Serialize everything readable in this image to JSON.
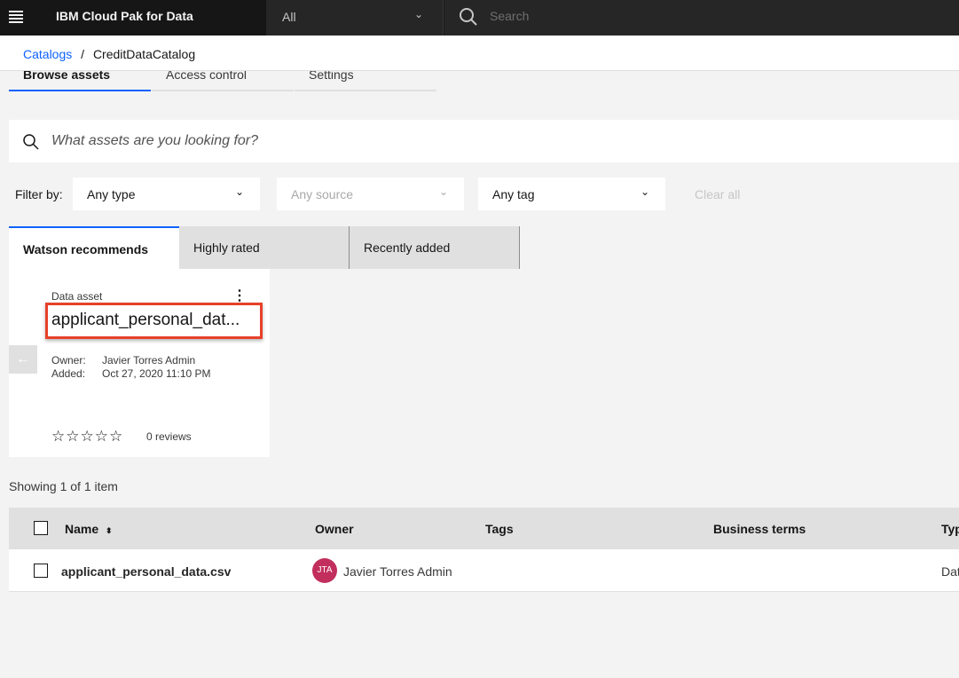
{
  "topbar": {
    "brand": "IBM Cloud Pak for Data",
    "scope": "All",
    "search_placeholder": "Search"
  },
  "breadcrumb": {
    "root": "Catalogs",
    "separator": "/",
    "current": "CreditDataCatalog"
  },
  "tabs": [
    "Browse assets",
    "Access control",
    "Settings"
  ],
  "asset_search": {
    "placeholder": "What assets are you looking for?"
  },
  "filters": {
    "label": "Filter by:",
    "type": "Any type",
    "source": "Any source",
    "tag": "Any tag",
    "clear": "Clear all"
  },
  "card_tabs": [
    "Watson recommends",
    "Highly rated",
    "Recently added"
  ],
  "card": {
    "kind": "Data asset",
    "name": "applicant_personal_dat...",
    "owner_label": "Owner:",
    "owner": "Javier Torres Admin",
    "added_label": "Added:",
    "added": "Oct 27, 2020 11:10 PM",
    "rating": 0,
    "stars": "☆☆☆☆☆",
    "reviews": "0 reviews"
  },
  "showing": "Showing 1 of 1 item",
  "table": {
    "columns": [
      "Name",
      "Owner",
      "Tags",
      "Business terms",
      "Typ"
    ],
    "sort_icon": "⬍",
    "rows": [
      {
        "name": "applicant_personal_data.csv",
        "owner_initials": "JTA",
        "owner": "Javier Torres Admin",
        "tags": "",
        "terms": "",
        "type": "Dat"
      }
    ]
  },
  "colors": {
    "accent": "#0f62fe",
    "highlight": "#e8402a",
    "avatar": "#c22f5c"
  }
}
